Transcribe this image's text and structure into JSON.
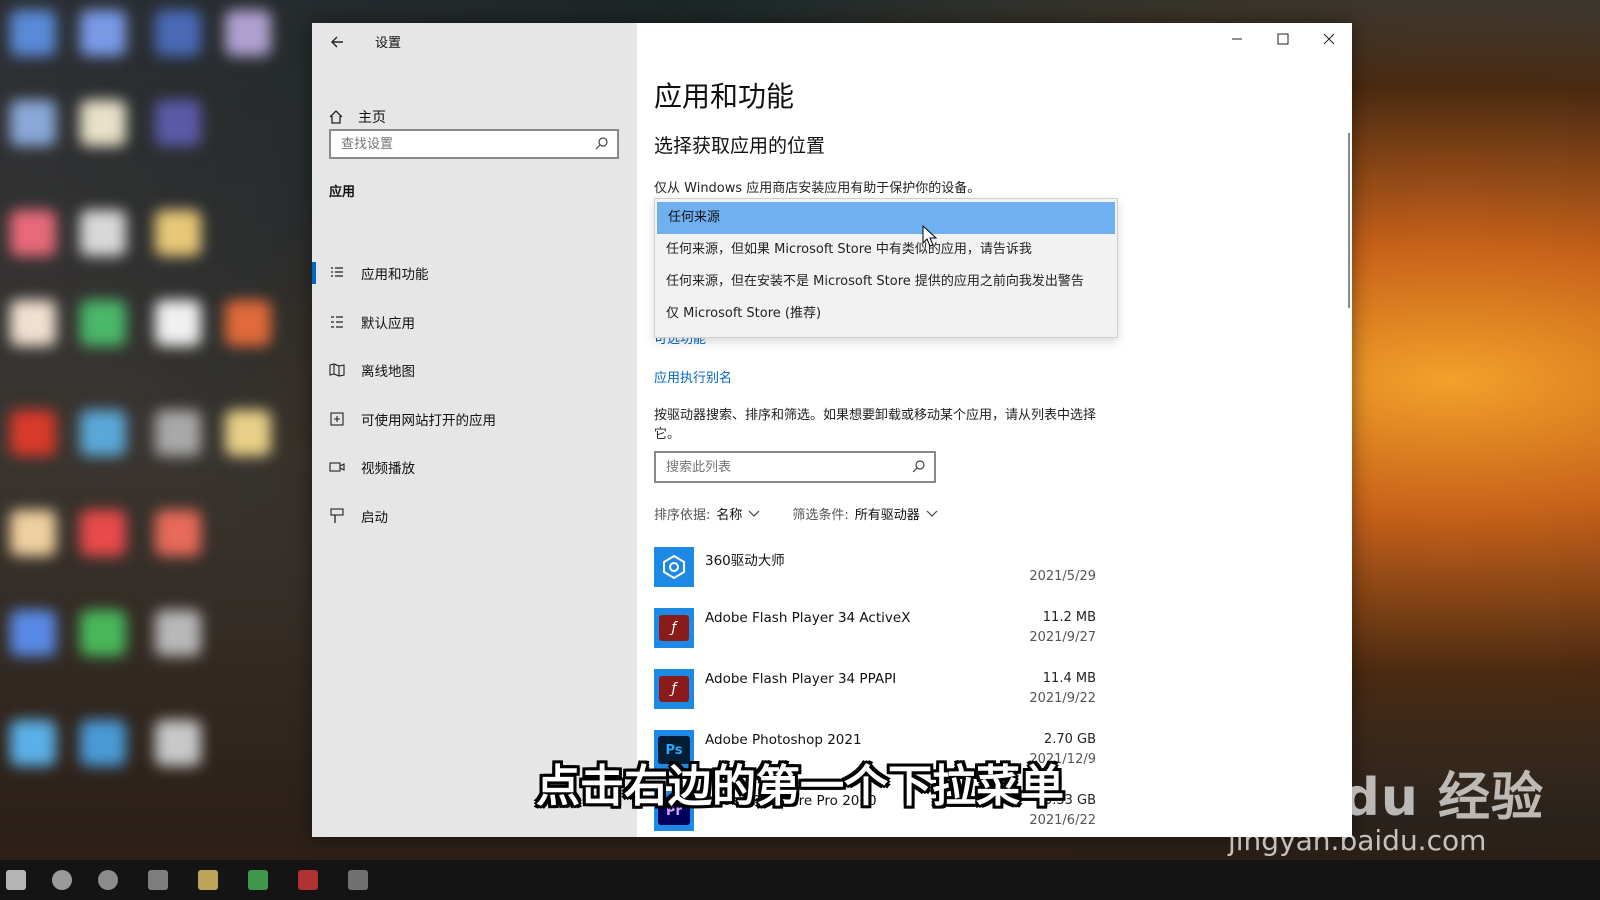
{
  "window": {
    "title": "设置",
    "home_label": "主页",
    "search_placeholder": "查找设置"
  },
  "sidebar": {
    "section": "应用",
    "items": [
      {
        "label": "应用和功能",
        "icon": "apps-features-icon",
        "active": true
      },
      {
        "label": "默认应用",
        "icon": "default-apps-icon",
        "active": false
      },
      {
        "label": "离线地图",
        "icon": "offline-maps-icon",
        "active": false
      },
      {
        "label": "可使用网站打开的应用",
        "icon": "apps-for-websites-icon",
        "active": false
      },
      {
        "label": "视频播放",
        "icon": "video-playback-icon",
        "active": false
      },
      {
        "label": "启动",
        "icon": "startup-icon",
        "active": false
      }
    ]
  },
  "main": {
    "heading": "应用和功能",
    "subheading": "选择获取应用的位置",
    "description": "仅从 Windows 应用商店安装应用有助于保护你的设备。",
    "dropdown_options": [
      "任何来源",
      "任何来源，但如果 Microsoft Store 中有类似的应用，请告诉我",
      "任何来源，但在安装不是 Microsoft Store 提供的应用之前向我发出警告",
      "仅 Microsoft Store (推荐)"
    ],
    "link_optional": "可选功能",
    "link_alias": "应用执行别名",
    "list_description": "按驱动器搜索、排序和筛选。如果想要卸载或移动某个应用，请从列表中选择它。",
    "list_search_placeholder": "搜索此列表",
    "sort_label": "排序依据:",
    "sort_value": "名称",
    "filter_label": "筛选条件:",
    "filter_value": "所有驱动器"
  },
  "apps": [
    {
      "name": "360驱动大师",
      "size": "",
      "date": "2021/5/29",
      "icon": "360-driver-icon",
      "color": "#1e88e5"
    },
    {
      "name": "Adobe Flash Player 34 ActiveX",
      "size": "11.2 MB",
      "date": "2021/9/27",
      "icon": "flash-icon",
      "color": "#8b1a1a"
    },
    {
      "name": "Adobe Flash Player 34 PPAPI",
      "size": "11.4 MB",
      "date": "2021/9/22",
      "icon": "flash-icon",
      "color": "#8b1a1a"
    },
    {
      "name": "Adobe Photoshop 2021",
      "size": "2.70 GB",
      "date": "2021/12/9",
      "icon": "photoshop-icon",
      "color": "#001e36"
    },
    {
      "name": "Adobe Premiere Pro 2020",
      "size": "3.33 GB",
      "date": "2021/6/22",
      "icon": "premiere-icon",
      "color": "#00005b"
    }
  ],
  "overlay": {
    "subtitle": "点击右边的第一个下拉菜单",
    "watermark_logo": "Bai du 经验",
    "watermark_url": "jingyan.baidu.com"
  },
  "colors": {
    "accent": "#0067c0",
    "selected_option": "#6fb1f0",
    "sidebar_bg": "#e6e6e6"
  }
}
